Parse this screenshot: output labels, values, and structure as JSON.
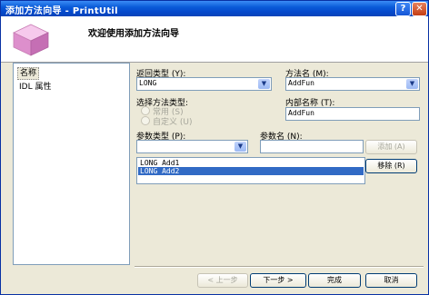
{
  "window": {
    "title": "添加方法向导 - PrintUtil",
    "help_label": "?",
    "close_label": "✕"
  },
  "header": {
    "title": "欢迎使用添加方法向导"
  },
  "nav": {
    "items": [
      "名称",
      "IDL 属性"
    ]
  },
  "form": {
    "return_type_label": "返回类型 (Y):",
    "return_type_value": "LONG",
    "method_name_label": "方法名 (M):",
    "method_name_value": "AddFun",
    "method_kind_label": "选择方法类型:",
    "kind_options": [
      "常用 (S)",
      "自定义 (U)"
    ],
    "internal_name_label": "内部名称 (T):",
    "internal_name_value": "AddFun",
    "param_type_label": "参数类型 (P):",
    "param_type_value": "",
    "param_name_label": "参数名 (N):",
    "param_name_value": "",
    "add_label": "添加 (A)",
    "remove_label": "移除 (R)",
    "params": [
      "LONG Add1",
      "LONG Add2"
    ]
  },
  "footer": {
    "back_label": "< 上一步",
    "next_label": "下一步 >",
    "finish_label": "完成",
    "cancel_label": "取消"
  },
  "icons": {
    "dropdown": "chevron-down-icon",
    "wizard": "cube-icon"
  }
}
